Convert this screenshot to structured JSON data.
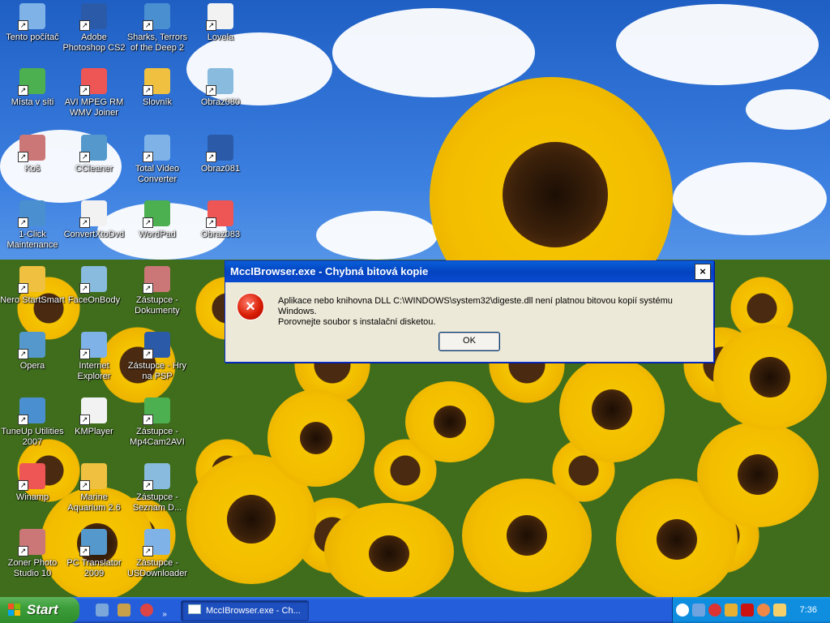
{
  "desktop": {
    "icons": [
      {
        "label": "Tento počítač",
        "icon": "computer-icon"
      },
      {
        "label": "Adobe Photoshop CS2",
        "icon": "photoshop-icon"
      },
      {
        "label": "Sharks, Terrors of the Deep 2",
        "icon": "shark-game-icon"
      },
      {
        "label": "Lovela",
        "icon": "document-icon"
      },
      {
        "label": "Místa v síti",
        "icon": "network-places-icon"
      },
      {
        "label": "AVI MPEG RM WMV Joiner",
        "icon": "video-joiner-icon"
      },
      {
        "label": "Slovník",
        "icon": "dictionary-icon"
      },
      {
        "label": "Obraz080",
        "icon": "image-file-icon"
      },
      {
        "label": "Koš",
        "icon": "recycle-bin-icon"
      },
      {
        "label": "CCleaner",
        "icon": "ccleaner-icon"
      },
      {
        "label": "Total Video Converter",
        "icon": "video-converter-icon"
      },
      {
        "label": "Obraz081",
        "icon": "image-file-icon"
      },
      {
        "label": "1-Click Maintenance",
        "icon": "maintenance-icon"
      },
      {
        "label": "ConvertXtoDvd",
        "icon": "dvd-converter-icon"
      },
      {
        "label": "WordPad",
        "icon": "wordpad-icon"
      },
      {
        "label": "Obraz083",
        "icon": "image-file-icon"
      },
      {
        "label": "Nero StartSmart",
        "icon": "nero-icon"
      },
      {
        "label": "FaceOnBody",
        "icon": "face-icon"
      },
      {
        "label": "Zástupce - Dokumenty",
        "icon": "documents-folder-icon"
      },
      {
        "label": "Opera",
        "icon": "opera-icon"
      },
      {
        "label": "Internet Explorer",
        "icon": "internet-explorer-icon"
      },
      {
        "label": "Zástupce - Hry na PSP",
        "icon": "document-icon"
      },
      {
        "label": "TuneUp Utilities 2007",
        "icon": "tuneup-icon"
      },
      {
        "label": "KMPlayer",
        "icon": "kmplayer-icon"
      },
      {
        "label": "Zástupce - Mp4Cam2AVI",
        "icon": "camera-icon"
      },
      {
        "label": "Winamp",
        "icon": "winamp-icon"
      },
      {
        "label": "Marine Aquarium 2.6",
        "icon": "aquarium-icon"
      },
      {
        "label": "Zástupce - Seznam D...",
        "icon": "document-icon"
      },
      {
        "label": "Zoner Photo Studio 10",
        "icon": "zoner-icon"
      },
      {
        "label": "PC Translator 2009",
        "icon": "translator-icon"
      },
      {
        "label": "Zástupce - USDownloader",
        "icon": "downloader-icon"
      }
    ]
  },
  "dialog": {
    "title": "MccIBrowser.exe - Chybná bitová kopie",
    "close_glyph": "×",
    "error_glyph": "×",
    "message_line1": "Aplikace nebo knihovna DLL C:\\WINDOWS\\system32\\digeste.dll není platnou bitovou kopií systému Windows.",
    "message_line2": "Porovnejte soubor s instalační disketou.",
    "ok_label": "OK"
  },
  "taskbar": {
    "start_label": "Start",
    "task_label": "MccIBrowser.exe - Ch...",
    "clock": "7:36"
  }
}
